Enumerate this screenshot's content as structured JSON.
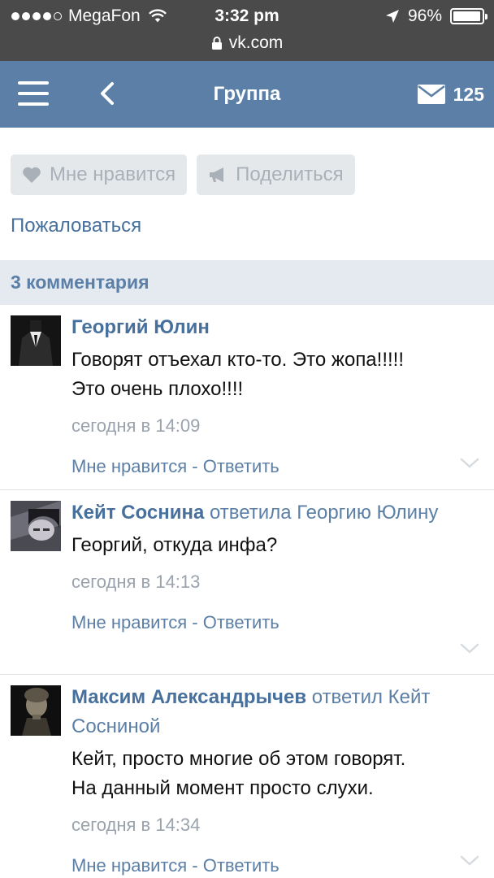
{
  "status_bar": {
    "carrier": "MegaFon",
    "time": "3:32 pm",
    "battery": "96%",
    "battery_level": 0.96,
    "url": "vk.com"
  },
  "navbar": {
    "title": "Группа",
    "messages_count": "125",
    "icons": [
      "menu-icon",
      "back-icon",
      "envelope-icon"
    ]
  },
  "actions": {
    "like": "Мне нравится",
    "share": "Поделиться",
    "complain": "Пожаловаться"
  },
  "comments_header": "3 комментария",
  "comments": [
    {
      "author": "Георгий Юлин",
      "reply_to": "",
      "text_lines": [
        "Говорят отъехал кто-то. Это жопа!!!!!",
        "Это очень плохо!!!!"
      ],
      "time": "сегодня в 14:09",
      "like": "Мне нравится",
      "sep": " - ",
      "reply": "Ответить"
    },
    {
      "author": "Кейт Соснина",
      "reply_to": " ответила Георгию Юлину",
      "text_lines": [
        "Георгий, откуда инфа?"
      ],
      "time": "сегодня в 14:13",
      "like": "Мне нравится",
      "sep": " - ",
      "reply": "Ответить"
    },
    {
      "author": "Максим Александрычев",
      "reply_to": " ответил Кейт Сосниной",
      "text_lines": [
        "Кейт, просто многие об этом говорят.",
        "На данный момент просто слухи."
      ],
      "time": "сегодня в 14:34",
      "like": "Мне нравится",
      "sep": " - ",
      "reply": "Ответить"
    }
  ],
  "colors": {
    "navbar": "#5b7fa6",
    "link": "#47709c",
    "status_bar": "#4a4a4a",
    "button_bg": "#e5e8eb"
  }
}
